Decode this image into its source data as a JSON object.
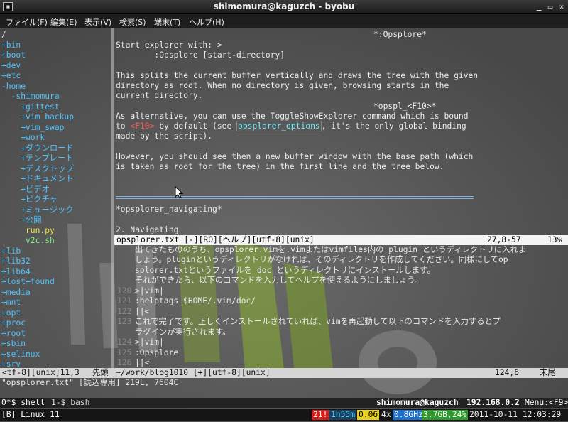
{
  "window": {
    "title": "shimomura@kaguzch - byobu"
  },
  "menu": [
    "ファイル(F)",
    "編集(E)",
    "表示(V)",
    "検索(S)",
    "端末(T)",
    "ヘルプ(H)"
  ],
  "tree": [
    {
      "text": "/",
      "cls": ""
    },
    {
      "text": "+bin",
      "cls": "plus"
    },
    {
      "text": "+boot",
      "cls": "plus"
    },
    {
      "text": "+dev",
      "cls": "plus"
    },
    {
      "text": "+etc",
      "cls": "plus"
    },
    {
      "text": "-home",
      "cls": "plus"
    },
    {
      "text": "  -shimomura",
      "cls": "plus"
    },
    {
      "text": "    +gittest",
      "cls": "plus"
    },
    {
      "text": "    +vim_backup",
      "cls": "plus"
    },
    {
      "text": "    +vim_swap",
      "cls": "plus"
    },
    {
      "text": "    +work",
      "cls": "plus"
    },
    {
      "text": "    +ダウンロード",
      "cls": "plus"
    },
    {
      "text": "    +テンプレート",
      "cls": "plus"
    },
    {
      "text": "    +デスクトップ",
      "cls": "plus"
    },
    {
      "text": "    +ドキュメント",
      "cls": "plus"
    },
    {
      "text": "    +ビデオ",
      "cls": "plus"
    },
    {
      "text": "    +ピクチャ",
      "cls": "plus"
    },
    {
      "text": "    +ミュージック",
      "cls": "plus"
    },
    {
      "text": "    +公開",
      "cls": "plus"
    },
    {
      "text": "     run.py",
      "cls": "ylw"
    },
    {
      "text": "     v2c.sh",
      "cls": "grn"
    },
    {
      "text": "+lib",
      "cls": "plus"
    },
    {
      "text": "+lib32",
      "cls": "plus"
    },
    {
      "text": "+lib64",
      "cls": "plus"
    },
    {
      "text": "+lost+found",
      "cls": "plus"
    },
    {
      "text": "+media",
      "cls": "plus"
    },
    {
      "text": "+mnt",
      "cls": "plus"
    },
    {
      "text": "+opt",
      "cls": "plus"
    },
    {
      "text": "+proc",
      "cls": "plus"
    },
    {
      "text": "+root",
      "cls": "plus"
    },
    {
      "text": "+sbin",
      "cls": "plus"
    },
    {
      "text": "+selinux",
      "cls": "plus"
    },
    {
      "text": "+srv",
      "cls": "plus"
    }
  ],
  "help": {
    "tag_top": "*:Opsplore*",
    "l1": "Start explorer with: >",
    "l2": "        :Opsplore [start-directory]",
    "p1": [
      "This splits the current buffer vertically and draws the tree with the given",
      "directory as root. When no directory is given, browsing starts in the",
      "current directory."
    ],
    "tag2": "*opspl_<F10>*",
    "p2a": "As alternative, you can use the ToggleShowExplorer command which is bound",
    "p2b_pre": "to ",
    "p2b_key": "<F10>",
    "p2b_mid": " by default (see ",
    "p2b_link": "opsplorer_options",
    "p2b_post": ", it's the only global binding",
    "p2c": "made by the script).",
    "p3": [
      "However, you should see then a new buffer window with the base path (which",
      "is taken as root for the tree) in the first line and the tree below."
    ],
    "tag3": "*opsplorer_navigating*",
    "section": "2. Navigating"
  },
  "status_help": {
    "file": "opsplorer.txt [-][RO][ヘルプ][utf-8][unix]",
    "pos": "27,8-57",
    "pct": "13%"
  },
  "lower": [
    {
      "n": "",
      "t": "出てきたもののうち、opsplorer.vimを.vimまたはvimfiles内の plugin というディレクトリに入れま"
    },
    {
      "n": "",
      "t": "しょう。pluginというディレクトリがなければ、そのディレクトリを作成してください。同様にしてop"
    },
    {
      "n": "",
      "t": "splorer.txtというファイルを doc というディレクトリにインストールします。"
    },
    {
      "n": "",
      "t": "それができたら、以下のコマンドを入力してヘルプを使えるようにしましょう。"
    },
    {
      "n": "120",
      "t": ">|vim|"
    },
    {
      "n": "121",
      "t": ":helptags $HOME/.vim/doc/"
    },
    {
      "n": "122",
      "t": "||<"
    },
    {
      "n": "123",
      "t": "これで完了です。正しくインストールされていれば、vimを再起動して以下のコマンドを入力するとプ"
    },
    {
      "n": "",
      "t": "ラグインが実行されます。"
    },
    {
      "n": "124",
      "t": ">|vim|"
    },
    {
      "n": "125",
      "t": ":Opsplore"
    },
    {
      "n": "126",
      "t": "||<"
    }
  ],
  "status_bottom": {
    "left": "<tf-8][unix]11,3",
    "left2": "先頭",
    "file": "~/work/blog1010 [+][utf-8][unix]",
    "pos": "124,6",
    "pct": "末尾"
  },
  "cmdline": "\"opsplorer.txt\" [読込専用] 219L, 7604C",
  "byobu": {
    "host": "shimomura@kaguzch",
    "ip": "192.168.0.2",
    "menu": "Menu:<F9>",
    "win0": "0*$ shell",
    "win1": "1-$ bash",
    "os": "[B] Linux 11",
    "updates": "21!",
    "uptime": "1h55m",
    "load": "0.06",
    "cpu_count": "4x",
    "cpu_freq": "0.8GHz",
    "mem": "3.7GB,24%",
    "datetime": "2011-10-11 12:03:29"
  },
  "colors": {
    "tree_plus": "#4ec4ff",
    "help_tag": "#ff7a7a",
    "cyan": "#66e0ff",
    "byobu_red": "#d61b1b",
    "byobu_green": "#2e9a2e",
    "byobu_yellow": "#e8d21a",
    "byobu_blue": "#1c70d0"
  }
}
